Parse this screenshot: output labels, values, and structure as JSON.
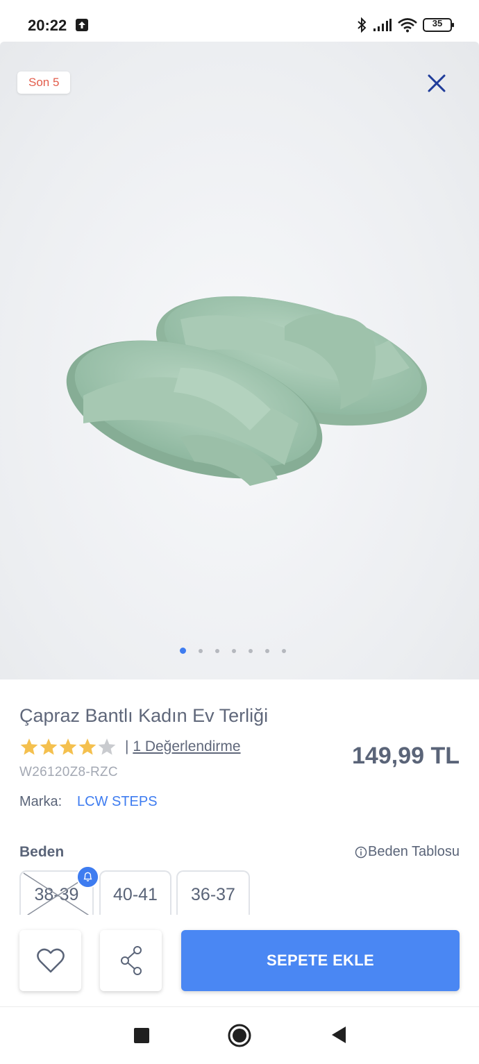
{
  "status_bar": {
    "time": "20:22",
    "battery": "35",
    "icons": [
      "upload-icon",
      "bluetooth-icon",
      "signal-icon",
      "wifi-icon",
      "battery-icon"
    ]
  },
  "product_image": {
    "badge": "Son 5",
    "dots_count": 7,
    "active_dot": 1
  },
  "product": {
    "title": "Çapraz Bantlı Kadın Ev Terliği",
    "rating": 4,
    "rating_max": 5,
    "review_separator": "|",
    "review_link": "1 Değerlendirme",
    "sku": "W26120Z8-RZC",
    "price": "149,99 TL",
    "brand_label": "Marka:",
    "brand": "LCW STEPS"
  },
  "size": {
    "title": "Beden",
    "chart_link": "Beden Tablosu",
    "options": [
      {
        "label": "38-39",
        "available": false
      },
      {
        "label": "40-41",
        "available": true
      },
      {
        "label": "36-37",
        "available": true
      }
    ]
  },
  "actions": {
    "add_to_cart": "SEPETE EKLE"
  },
  "colors": {
    "accent": "#4a87f3",
    "link": "#3e7cf0",
    "badge_text": "#e25c4b",
    "star": "#f4c04e",
    "star_empty": "#c9cbcf",
    "text": "#5a6478"
  }
}
